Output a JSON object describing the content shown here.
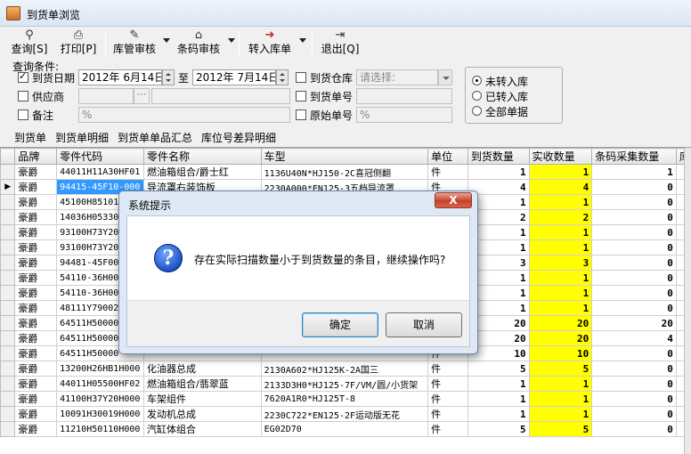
{
  "window": {
    "title": "到货单浏览"
  },
  "toolbar": {
    "query": "查询[S]",
    "print": "打印[P]",
    "warehouse_review": "库管审核",
    "barcode_review": "条码审核",
    "transfer_stock": "转入库单",
    "exit": "退出[Q]"
  },
  "query": {
    "label": "查询条件:",
    "arrival_date_label": "到货日期",
    "date_from": "2012年 6月14日",
    "to_label": "至",
    "date_to": "2012年 7月14日",
    "arrival_warehouse_label": "到货仓库",
    "warehouse_placeholder": "请选择:",
    "supplier_label": "供应商",
    "arrival_no_label": "到货单号",
    "remark_label": "备注",
    "remark_value": "%",
    "original_no_label": "原始单号",
    "original_no_value": "%",
    "radio_not_in": "未转入库",
    "radio_in": "已转入库",
    "radio_all": "全部单据"
  },
  "tabs": [
    "到货单",
    "到货单明细",
    "到货单单品汇总",
    "库位号差异明细"
  ],
  "grid": {
    "headers": [
      "品牌",
      "零件代码",
      "零件名称",
      "车型",
      "单位",
      "到货数量",
      "实收数量",
      "条码采集数量",
      "库"
    ],
    "rows": [
      [
        "豪爵",
        "44011H11A30HF01",
        "燃油箱组合/爵士红",
        "1136U40N*HJ150-2C喜冠侧翻",
        "件",
        "1",
        "1",
        "1"
      ],
      [
        "豪爵",
        "94415-45F10-000",
        "导流罩右装饰板",
        "2230A000*EN125-3五档导流罩",
        "件",
        "4",
        "4",
        "0"
      ],
      [
        "豪爵",
        "45100H85101",
        "",
        "",
        "件",
        "1",
        "1",
        "0"
      ],
      [
        "豪爵",
        "14036H05330",
        "",
        "",
        "件",
        "2",
        "2",
        "0"
      ],
      [
        "豪爵",
        "93100H73Y20",
        "",
        "",
        "件",
        "1",
        "1",
        "0"
      ],
      [
        "豪爵",
        "93100H73Y20",
        "",
        "",
        "件",
        "1",
        "1",
        "0"
      ],
      [
        "豪爵",
        "94481-45F00",
        "",
        "",
        "件",
        "3",
        "3",
        "0"
      ],
      [
        "豪爵",
        "54110-36H00",
        "",
        "",
        "件",
        "1",
        "1",
        "0"
      ],
      [
        "豪爵",
        "54110-36H00",
        "",
        "",
        "件",
        "1",
        "1",
        "0"
      ],
      [
        "豪爵",
        "48111Y79002",
        "",
        "",
        "件",
        "1",
        "1",
        "0"
      ],
      [
        "豪爵",
        "64511H50000",
        "",
        "",
        "件",
        "20",
        "20",
        "20"
      ],
      [
        "豪爵",
        "64511H50000",
        "",
        "",
        "件",
        "20",
        "20",
        "4"
      ],
      [
        "豪爵",
        "64511H50000",
        "",
        "",
        "件",
        "10",
        "10",
        "0"
      ],
      [
        "豪爵",
        "13200H26HB1H000",
        "化油器总成",
        "2130A602*HJ125K-2A国三",
        "件",
        "5",
        "5",
        "0"
      ],
      [
        "豪爵",
        "44011H05500HF02",
        "燃油箱组合/翡翠蓝",
        "2133D3H0*HJ125-7F/VM/圆/小货架",
        "件",
        "1",
        "1",
        "0"
      ],
      [
        "豪爵",
        "41100H37Y20H000",
        "车架组件",
        "7620A1R0*HJ125T-8",
        "件",
        "1",
        "1",
        "0"
      ],
      [
        "豪爵",
        "10091H30019H000",
        "发动机总成",
        "2230C722*EN125-2F运动版无花",
        "件",
        "1",
        "1",
        "0"
      ],
      [
        "豪爵",
        "11210H50110H000",
        "汽缸体组合",
        "EG02D70",
        "件",
        "5",
        "5",
        "0"
      ]
    ]
  },
  "dialog": {
    "title": "系统提示",
    "close": "X",
    "message": "存在实际扫描数量小于到货数量的条目，继续操作吗?",
    "ok": "确定",
    "cancel": "取消"
  }
}
